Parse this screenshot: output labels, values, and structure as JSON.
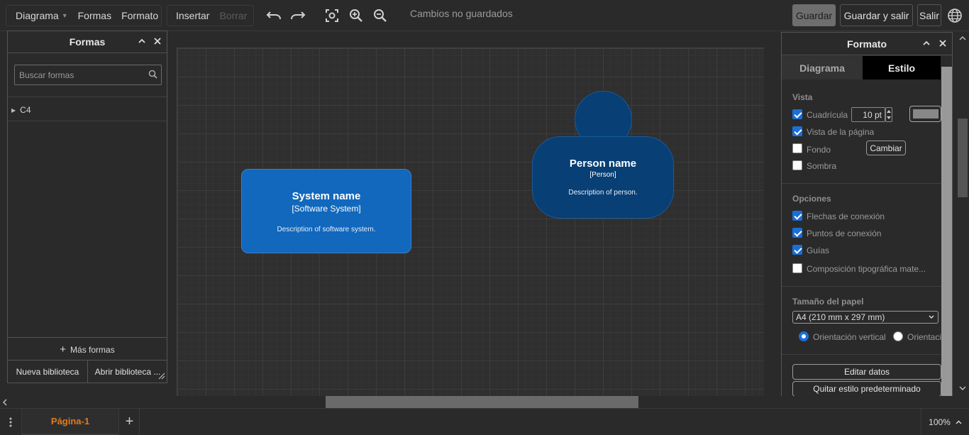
{
  "toolbar": {
    "menu_diagrama": "Diagrama",
    "menu_formas": "Formas",
    "menu_formato": "Formato",
    "insertar": "Insertar",
    "borrar": "Borrar",
    "status": "Cambios no guardados",
    "guardar": "Guardar",
    "guardar_y_salir": "Guardar y salir",
    "salir": "Salir"
  },
  "shapes_panel": {
    "title": "Formas",
    "search_placeholder": "Buscar formas",
    "library": "C4",
    "more_shapes": "Más formas",
    "new_library": "Nueva biblioteca",
    "open_library": "Abrir biblioteca ..."
  },
  "canvas": {
    "system": {
      "title": "System name",
      "type": "[Software System]",
      "description": "Description of software system.",
      "color": "#1168bd"
    },
    "person": {
      "title": "Person name",
      "type": "[Person]",
      "description": "Description of person.",
      "color": "#083f75"
    }
  },
  "format_panel": {
    "title": "Formato",
    "tab_diagrama": "Diagrama",
    "tab_estilo": "Estilo",
    "vista_heading": "Vista",
    "cuadricula": "Cuadrícula",
    "grid_size": "10 pt",
    "vista_pagina": "Vista de la página",
    "fondo": "Fondo",
    "cambiar": "Cambiar",
    "sombra": "Sombra",
    "opciones_heading": "Opciones",
    "flechas": "Flechas de conexión",
    "puntos": "Puntos de conexión",
    "guias": "Guías",
    "tipografica": "Composición tipográfica mate...",
    "papel_heading": "Tamaño del papel",
    "paper_size": "A4 (210 mm x 297 mm)",
    "orient_vertical": "Orientación vertical",
    "orient_horizontal": "Orientaci",
    "editar_datos": "Editar datos",
    "quitar_estilo": "Quitar estilo predeterminado",
    "checks": {
      "cuadricula": true,
      "vista_pagina": true,
      "fondo": false,
      "sombra": false,
      "flechas": true,
      "puntos": true,
      "guias": true,
      "tipografica": false
    }
  },
  "bottom": {
    "page_tab": "Página-1",
    "zoom": "100%"
  }
}
